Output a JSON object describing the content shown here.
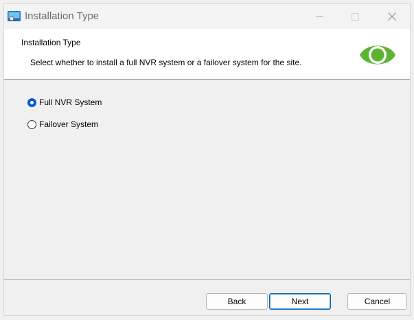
{
  "window": {
    "title": "Installation Type",
    "icon": "installer-icon",
    "controls": [
      "minimize-icon",
      "maximize-icon",
      "close-icon"
    ]
  },
  "header": {
    "title": "Installation Type",
    "description": "Select whether to install a full NVR system or a failover system for the site.",
    "logo": "eye-logo-icon",
    "logo_color": "#5bb532"
  },
  "options": [
    {
      "label": "Full NVR System",
      "selected": true
    },
    {
      "label": "Failover System",
      "selected": false
    }
  ],
  "accent_color": "#0a5bd3",
  "buttons": {
    "back": "Back",
    "next": "Next",
    "cancel": "Cancel"
  }
}
